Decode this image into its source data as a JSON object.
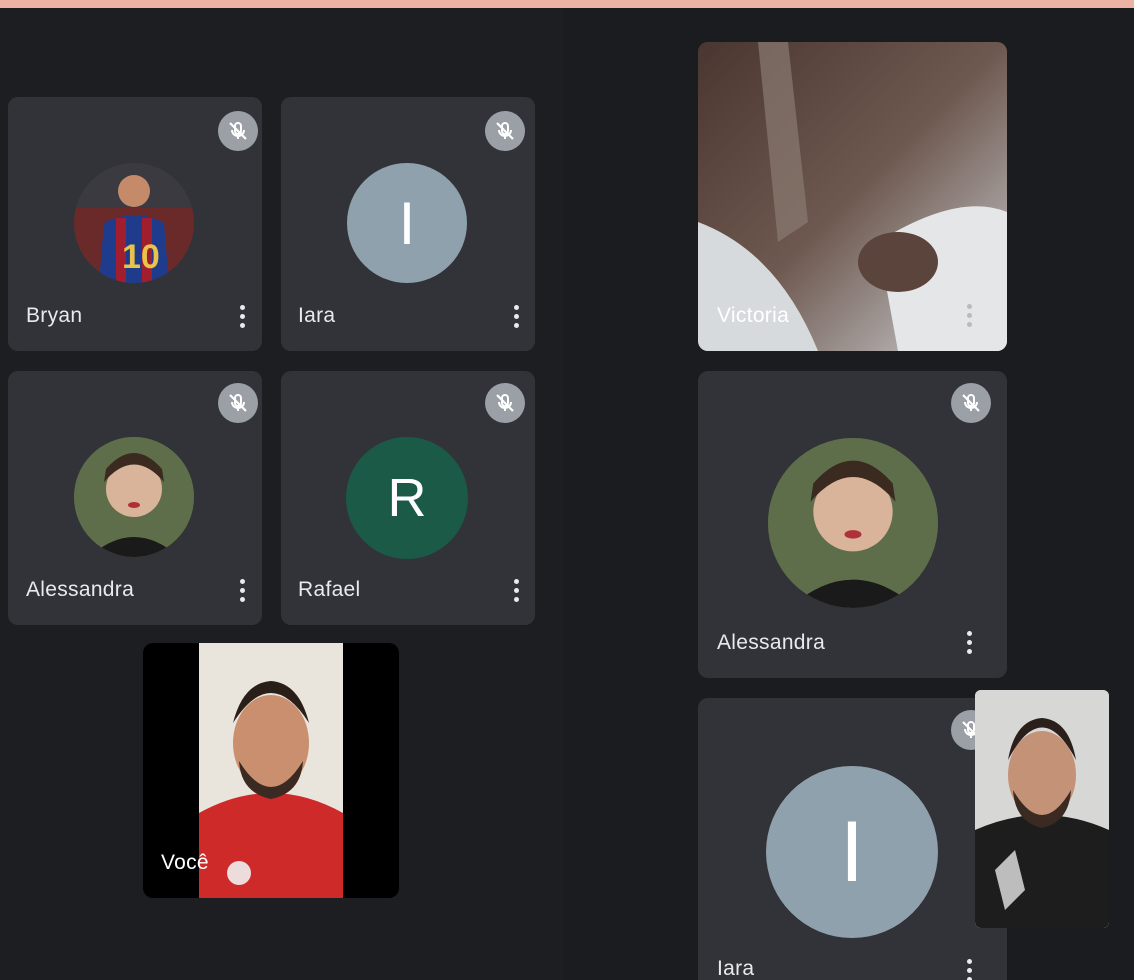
{
  "left_grid": {
    "tiles": [
      {
        "name": "Bryan",
        "avatar": "photo",
        "muted": true
      },
      {
        "name": "Iara",
        "avatar_letter": "I",
        "avatar_color": "#8ea1ad",
        "muted": true
      },
      {
        "name": "Alessandra",
        "avatar": "photo",
        "muted": true
      },
      {
        "name": "Rafael",
        "avatar_letter": "R",
        "avatar_color": "#1b5a46",
        "muted": true
      }
    ],
    "self_tile": {
      "name": "Você"
    }
  },
  "right_grid": {
    "tiles": [
      {
        "name": "Victoria",
        "video": true
      },
      {
        "name": "Alessandra",
        "avatar": "photo",
        "muted": true
      },
      {
        "name": "Iara",
        "avatar_letter": "I",
        "avatar_color": "#8ea1ad",
        "muted": true
      }
    ],
    "self_pip": {
      "video": true
    }
  },
  "icons": {
    "mute": "mic-off-icon",
    "more": "more-vert-icon"
  },
  "colors": {
    "tile": "#313338",
    "background": "#1f2124",
    "top_strip": "#ecb3a4",
    "mute_badge": "#9aa0a6"
  }
}
